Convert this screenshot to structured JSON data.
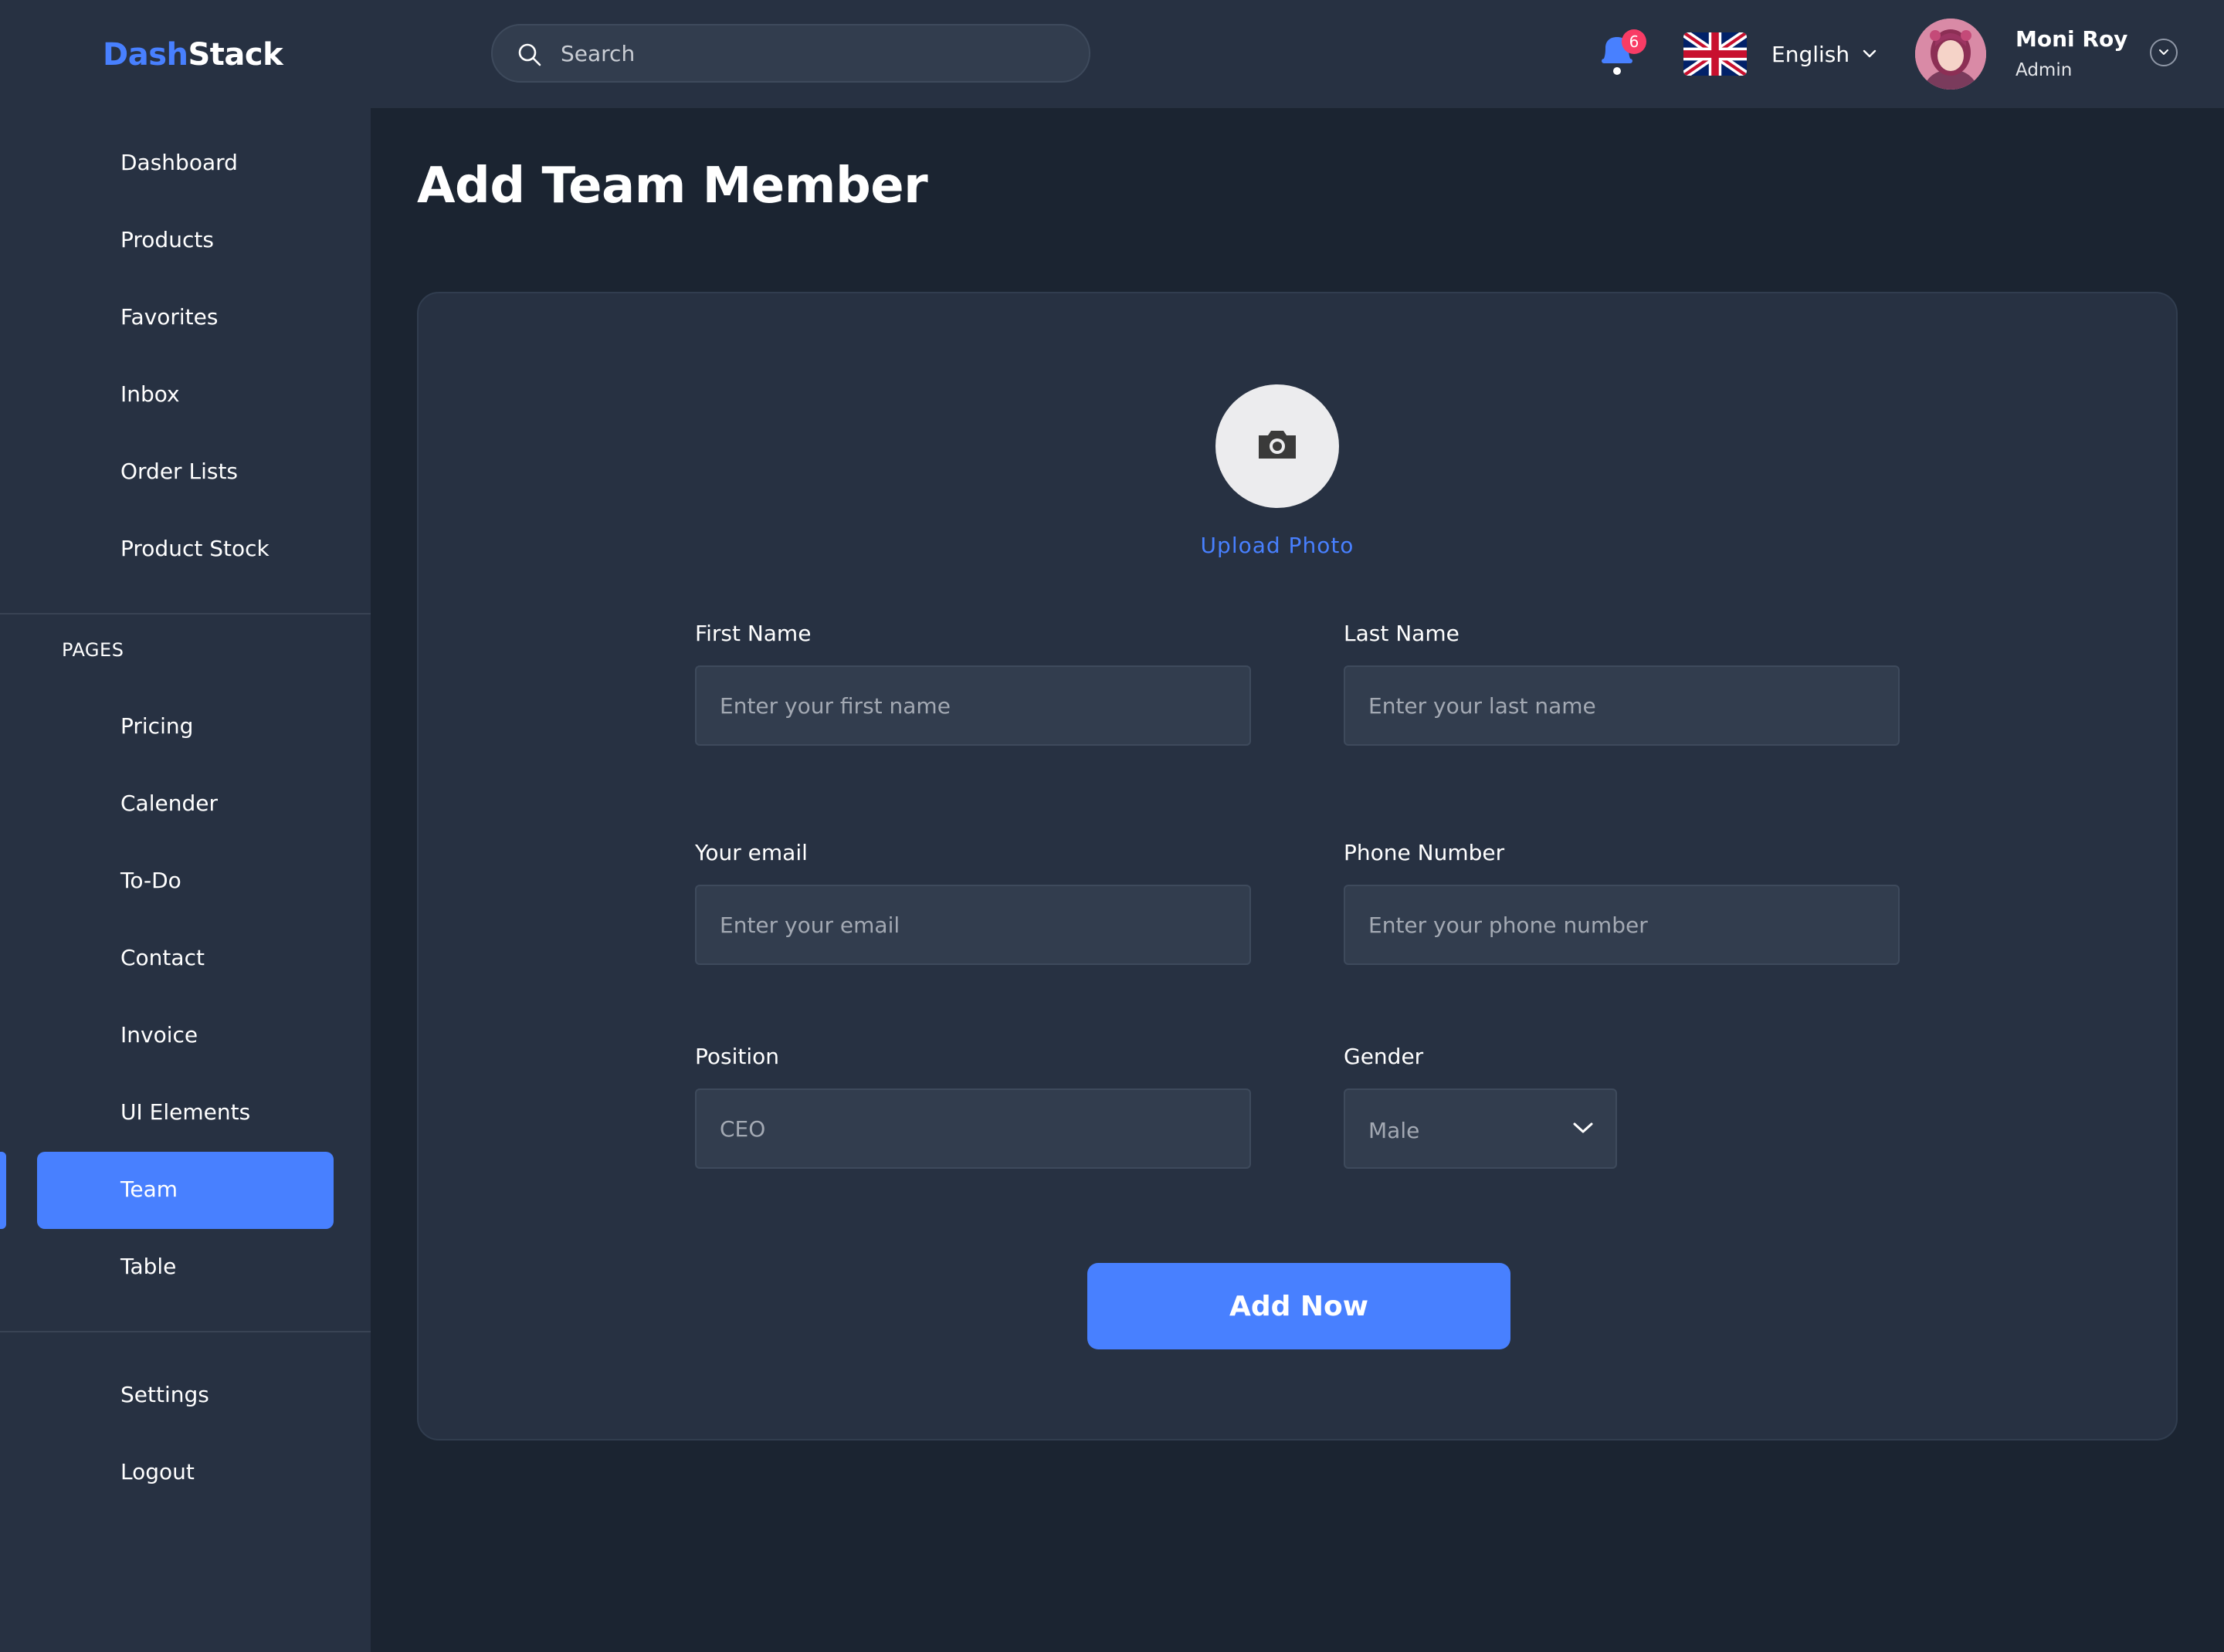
{
  "brand": {
    "part1": "Dash",
    "part2": "Stack"
  },
  "search": {
    "placeholder": "Search",
    "icon": "search-icon"
  },
  "header": {
    "notifications": {
      "count": "6",
      "icon": "bell-icon"
    },
    "language": {
      "label": "English",
      "flag": "uk-flag-icon"
    },
    "user": {
      "name": "Moni Roy",
      "role": "Admin"
    }
  },
  "sidebar": {
    "main_items": [
      {
        "label": "Dashboard"
      },
      {
        "label": "Products"
      },
      {
        "label": "Favorites"
      },
      {
        "label": "Inbox"
      },
      {
        "label": "Order Lists"
      },
      {
        "label": "Product Stock"
      }
    ],
    "pages_label": "PAGES",
    "page_items": [
      {
        "label": "Pricing"
      },
      {
        "label": "Calender"
      },
      {
        "label": "To-Do"
      },
      {
        "label": "Contact"
      },
      {
        "label": "Invoice"
      },
      {
        "label": "UI Elements"
      },
      {
        "label": "Team",
        "active": true
      },
      {
        "label": "Table"
      }
    ],
    "footer_items": [
      {
        "label": "Settings"
      },
      {
        "label": "Logout"
      }
    ]
  },
  "page": {
    "title": "Add Team Member",
    "upload_label": "Upload Photo",
    "form": {
      "first_name": {
        "label": "First Name",
        "placeholder": "Enter your first name"
      },
      "last_name": {
        "label": "Last Name",
        "placeholder": "Enter your last name"
      },
      "email": {
        "label": "Your email",
        "placeholder": "Enter your email"
      },
      "phone": {
        "label": "Phone Number",
        "placeholder": "Enter your phone number"
      },
      "position": {
        "label": "Position",
        "placeholder": "CEO"
      },
      "gender": {
        "label": "Gender",
        "value": "Male"
      }
    },
    "submit_label": "Add Now"
  },
  "colors": {
    "accent": "#4880ff",
    "sidebar_bg": "#273142",
    "page_bg": "#1b2431",
    "badge": "#f93c65"
  }
}
